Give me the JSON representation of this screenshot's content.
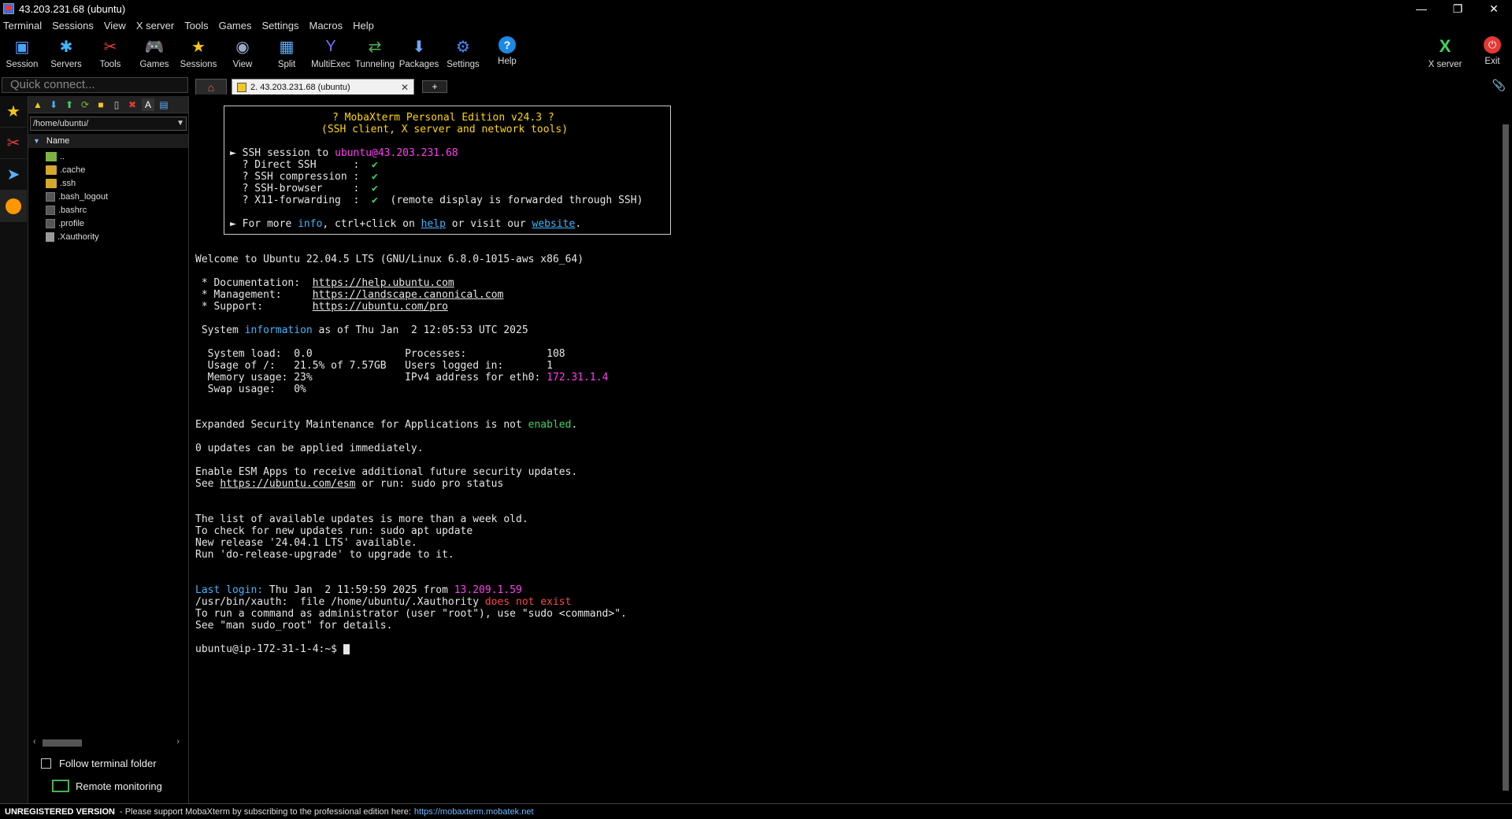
{
  "window": {
    "title": "43.203.231.68 (ubuntu)",
    "minimize": "—",
    "restore": "❐",
    "close": "✕"
  },
  "menu": [
    "Terminal",
    "Sessions",
    "View",
    "X server",
    "Tools",
    "Games",
    "Settings",
    "Macros",
    "Help"
  ],
  "toolbar": {
    "items": [
      {
        "label": "Session",
        "icon": "session-icon"
      },
      {
        "label": "Servers",
        "icon": "servers-icon"
      },
      {
        "label": "Tools",
        "icon": "tools-icon"
      },
      {
        "label": "Games",
        "icon": "games-icon"
      },
      {
        "label": "Sessions",
        "icon": "star-icon"
      },
      {
        "label": "View",
        "icon": "view-icon"
      },
      {
        "label": "Split",
        "icon": "split-icon"
      },
      {
        "label": "MultiExec",
        "icon": "multiexec-icon"
      },
      {
        "label": "Tunneling",
        "icon": "tunneling-icon"
      },
      {
        "label": "Packages",
        "icon": "packages-icon"
      },
      {
        "label": "Settings",
        "icon": "settings-icon"
      },
      {
        "label": "Help",
        "icon": "help-icon"
      }
    ],
    "xserver_label": "X server",
    "exit_label": "Exit"
  },
  "quick_connect": {
    "placeholder": "Quick connect..."
  },
  "tabs": {
    "session_tab": "2. 43.203.231.68 (ubuntu)",
    "close": "✕",
    "new": "+"
  },
  "sidebar": {
    "path": "/home/ubuntu/",
    "column": "Name",
    "files": [
      {
        "name": "..",
        "type": "up"
      },
      {
        "name": ".cache",
        "type": "folder"
      },
      {
        "name": ".ssh",
        "type": "folder"
      },
      {
        "name": ".bash_logout",
        "type": "file"
      },
      {
        "name": ".bashrc",
        "type": "file"
      },
      {
        "name": ".profile",
        "type": "file"
      },
      {
        "name": ".Xauthority",
        "type": "xfile"
      }
    ],
    "follow_label": "Follow terminal folder",
    "remote_label": "Remote monitoring"
  },
  "terminal": {
    "banner_title": "? MobaXterm Personal Edition v24.3 ?",
    "banner_sub": "(SSH client, X server and network tools)",
    "ssh_session_prefix": "► SSH session to ",
    "ssh_target": "ubuntu@43.203.231.68",
    "direct_ssh": "  ? Direct SSH      :  ",
    "ssh_compression": "  ? SSH compression :  ",
    "ssh_browser": "  ? SSH-browser     :  ",
    "x11": "  ? X11-forwarding  :  ",
    "check": "✔",
    "x11_note": "  (remote display is forwarded through SSH)",
    "more_prefix": "► For more ",
    "more_info": "info",
    "more_mid": ", ctrl+click on ",
    "more_help": "help",
    "more_or": " or visit our ",
    "more_website": "website",
    "more_end": ".",
    "welcome": "Welcome to Ubuntu 22.04.5 LTS (GNU/Linux 6.8.0-1015-aws x86_64)",
    "doc_label": " * Documentation:  ",
    "doc_url": "https://help.ubuntu.com",
    "mgmt_label": " * Management:     ",
    "mgmt_url": "https://landscape.canonical.com",
    "support_label": " * Support:        ",
    "support_url": "https://ubuntu.com/pro",
    "sysinfo_pre": " System ",
    "sysinfo_word": "information",
    "sysinfo_post": " as of Thu Jan  2 12:05:53 UTC 2025",
    "load_line": "  System load:  0.0               Processes:             108",
    "usage_line": "  Usage of /:   21.5% of 7.57GB   Users logged in:       1",
    "mem_pre": "  Memory usage: 23%               IPv4 address for eth0: ",
    "ipv4": "172.31.1.4",
    "swap_line": "  Swap usage:   0%",
    "esm_pre": "Expanded Security Maintenance for Applications is not ",
    "esm_word": "enabled",
    "esm_end": ".",
    "updates": "0 updates can be applied immediately.",
    "esm_apps": "Enable ESM Apps to receive additional future security updates.",
    "see_pre": "See ",
    "see_url": "https://ubuntu.com/esm",
    "see_post": " or run: sudo pro status",
    "list_old": "The list of available updates is more than a week old.",
    "check_new": "To check for new updates run: sudo apt update",
    "new_release": "New release '24.04.1 LTS' available.",
    "run_upgrade": "Run 'do-release-upgrade' to upgrade to it.",
    "last_login_label": "Last login:",
    "last_login_mid": " Thu Jan  2 11:59:59 2025 from ",
    "last_login_ip": "13.209.1.59",
    "xauth_pre": "/usr/bin/xauth:  file /home/ubuntu/.Xauthority ",
    "xauth_err": "does not exist",
    "sudo1": "To run a command as administrator (user \"root\"), use \"sudo <command>\".",
    "sudo2": "See \"man sudo_root\" for details.",
    "prompt": "ubuntu@ip-172-31-1-4:~$ "
  },
  "status": {
    "unregistered": "UNREGISTERED VERSION",
    "text": " -  Please support MobaXterm by subscribing to the professional edition here: ",
    "link": "https://mobaxterm.mobatek.net"
  }
}
